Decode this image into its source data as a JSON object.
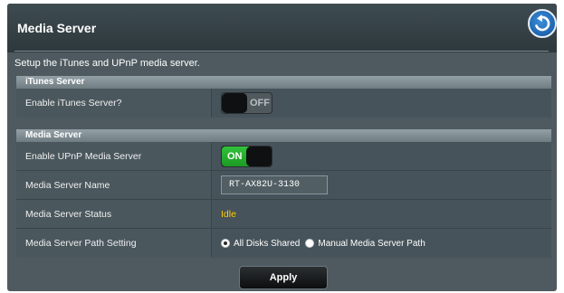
{
  "header": {
    "title": "Media Server",
    "back_icon": "back-arrow-icon",
    "description": "Setup the iTunes and UPnP media server."
  },
  "itunes_section": {
    "heading": "iTunes Server",
    "enable_label": "Enable iTunes Server?",
    "enable_state": "OFF"
  },
  "media_section": {
    "heading": "Media Server",
    "upnp_label": "Enable UPnP Media Server",
    "upnp_state": "ON",
    "name_label": "Media Server Name",
    "name_value": "RT-AX82U-3130",
    "status_label": "Media Server Status",
    "status_value": "Idle",
    "path_label": "Media Server Path Setting",
    "path_options": [
      {
        "label": "All Disks Shared",
        "selected": true
      },
      {
        "label": "Manual Media Server Path",
        "selected": false
      }
    ]
  },
  "actions": {
    "apply_label": "Apply"
  },
  "colors": {
    "panel": "#4e5a60",
    "accent_green": "#1c9a24",
    "status_yellow": "#ffcc00",
    "back_blue": "#1c64b0"
  }
}
